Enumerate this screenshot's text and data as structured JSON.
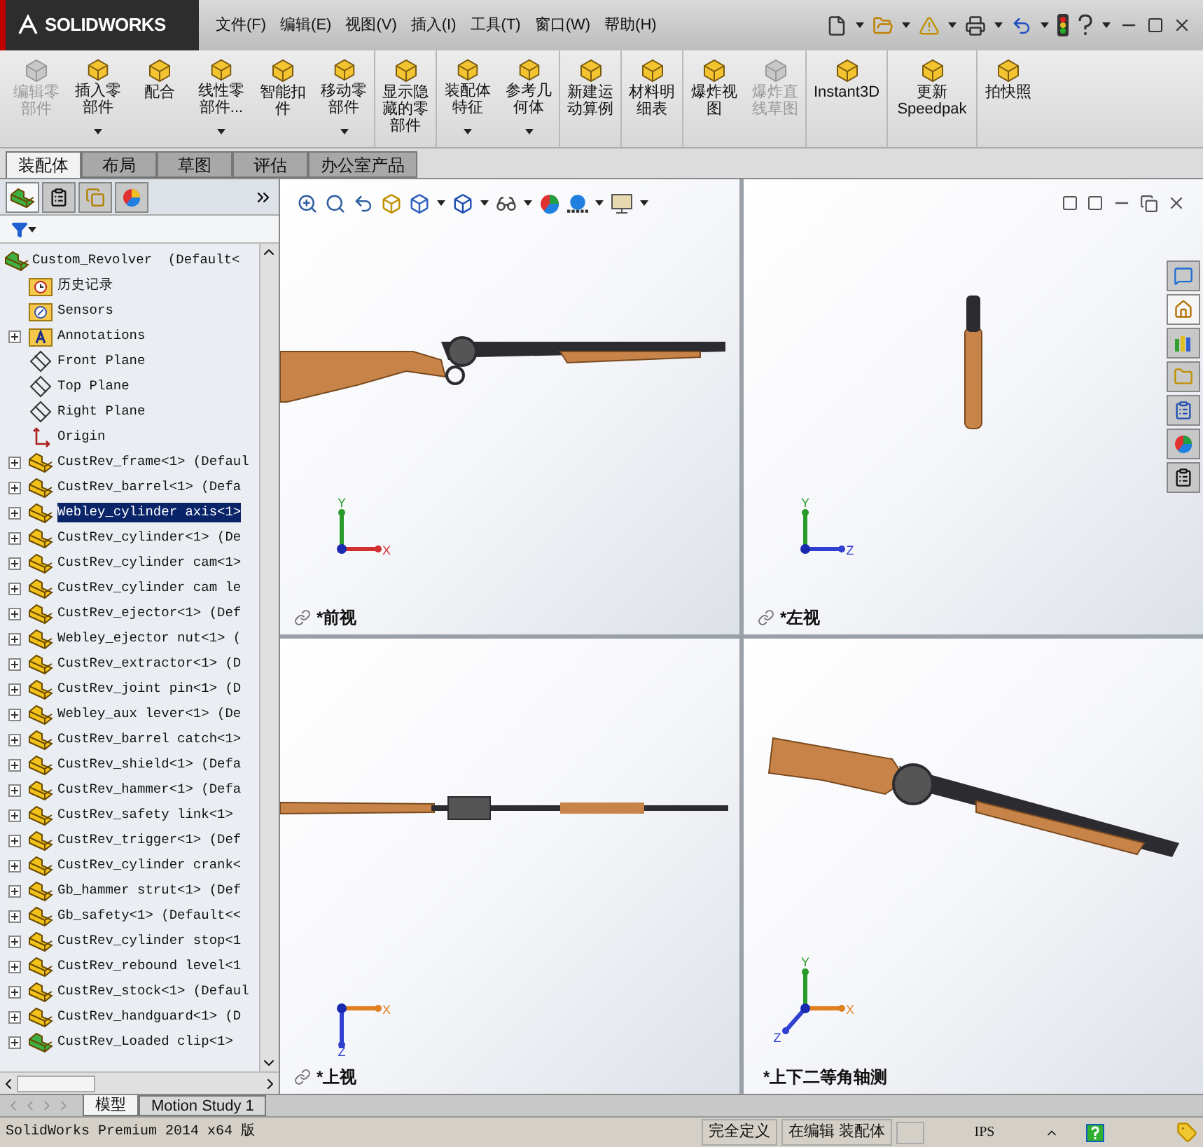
{
  "title_bar": {
    "logo": "SOLIDWORKS",
    "menu": [
      "文件(F)",
      "编辑(E)",
      "视图(V)",
      "插入(I)",
      "工具(T)",
      "窗口(W)",
      "帮助(H)"
    ]
  },
  "toolbar": [
    {
      "label": "编辑零部件",
      "disabled": true,
      "dropdown": false
    },
    {
      "label": "插入零部件",
      "disabled": false,
      "dropdown": true
    },
    {
      "label": "配合",
      "disabled": false,
      "dropdown": false
    },
    {
      "label": "线性零部件...",
      "disabled": false,
      "dropdown": true
    },
    {
      "label": "智能扣件",
      "disabled": false,
      "dropdown": false
    },
    {
      "label": "移动零部件",
      "disabled": false,
      "dropdown": true
    },
    {
      "label": "显示隐藏的零部件",
      "disabled": false,
      "dropdown": false
    },
    {
      "label": "装配体特征",
      "disabled": false,
      "dropdown": true
    },
    {
      "label": "参考几何体",
      "disabled": false,
      "dropdown": true
    },
    {
      "label": "新建运动算例",
      "disabled": false,
      "dropdown": false
    },
    {
      "label": "材料明细表",
      "disabled": false,
      "dropdown": false
    },
    {
      "label": "爆炸视图",
      "disabled": false,
      "dropdown": false
    },
    {
      "label": "爆炸直线草图",
      "disabled": true,
      "dropdown": false
    },
    {
      "label": "Instant3D",
      "disabled": false,
      "dropdown": false
    },
    {
      "label": "更新 Speedpak",
      "disabled": false,
      "dropdown": false
    },
    {
      "label": "拍快照",
      "disabled": false,
      "dropdown": false
    }
  ],
  "command_tabs": [
    {
      "label": "装配体",
      "selected": true
    },
    {
      "label": "布局",
      "selected": false
    },
    {
      "label": "草图",
      "selected": false
    },
    {
      "label": "评估",
      "selected": false
    },
    {
      "label": "办公室产品",
      "selected": false
    }
  ],
  "feature_tree": {
    "root": "Custom_Revolver  (Default<",
    "items": [
      {
        "label": "历史记录",
        "kind": "history",
        "expandable": false,
        "selected": false
      },
      {
        "label": "Sensors",
        "kind": "sensors",
        "expandable": false,
        "selected": false
      },
      {
        "label": "Annotations",
        "kind": "annotations",
        "expandable": true,
        "selected": false
      },
      {
        "label": "Front Plane",
        "kind": "plane",
        "expandable": false,
        "selected": false
      },
      {
        "label": "Top Plane",
        "kind": "plane",
        "expandable": false,
        "selected": false
      },
      {
        "label": "Right Plane",
        "kind": "plane",
        "expandable": false,
        "selected": false
      },
      {
        "label": "Origin",
        "kind": "origin",
        "expandable": false,
        "selected": false
      },
      {
        "label": "CustRev_frame<1> (Defaul",
        "kind": "part",
        "expandable": true,
        "selected": false
      },
      {
        "label": "CustRev_barrel<1> (Defa",
        "kind": "part",
        "expandable": true,
        "selected": false
      },
      {
        "label": "Webley_cylinder axis<1>",
        "kind": "part",
        "expandable": true,
        "selected": true
      },
      {
        "label": "CustRev_cylinder<1> (De",
        "kind": "part",
        "expandable": true,
        "selected": false
      },
      {
        "label": "CustRev_cylinder cam<1>",
        "kind": "part",
        "expandable": true,
        "selected": false
      },
      {
        "label": "CustRev_cylinder cam le",
        "kind": "part",
        "expandable": true,
        "selected": false
      },
      {
        "label": "CustRev_ejector<1> (Def",
        "kind": "part",
        "expandable": true,
        "selected": false
      },
      {
        "label": "Webley_ejector nut<1> (",
        "kind": "part",
        "expandable": true,
        "selected": false
      },
      {
        "label": "CustRev_extractor<1> (D",
        "kind": "part",
        "expandable": true,
        "selected": false
      },
      {
        "label": "CustRev_joint pin<1> (D",
        "kind": "part",
        "expandable": true,
        "selected": false
      },
      {
        "label": "Webley_aux lever<1> (De",
        "kind": "part",
        "expandable": true,
        "selected": false
      },
      {
        "label": "CustRev_barrel catch<1>",
        "kind": "part",
        "expandable": true,
        "selected": false
      },
      {
        "label": "CustRev_shield<1> (Defa",
        "kind": "part",
        "expandable": true,
        "selected": false
      },
      {
        "label": "CustRev_hammer<1> (Defa",
        "kind": "part",
        "expandable": true,
        "selected": false
      },
      {
        "label": "CustRev_safety link<1>",
        "kind": "part",
        "expandable": true,
        "selected": false
      },
      {
        "label": "CustRev_trigger<1> (Def",
        "kind": "part",
        "expandable": true,
        "selected": false
      },
      {
        "label": "CustRev_cylinder crank<",
        "kind": "part",
        "expandable": true,
        "selected": false
      },
      {
        "label": "Gb_hammer strut<1> (Def",
        "kind": "part",
        "expandable": true,
        "selected": false
      },
      {
        "label": "Gb_safety<1> (Default<<",
        "kind": "part",
        "expandable": true,
        "selected": false
      },
      {
        "label": "CustRev_cylinder stop<1",
        "kind": "part",
        "expandable": true,
        "selected": false
      },
      {
        "label": "CustRev_rebound level<1",
        "kind": "part",
        "expandable": true,
        "selected": false
      },
      {
        "label": "CustRev_stock<1> (Defaul",
        "kind": "part",
        "expandable": true,
        "selected": false
      },
      {
        "label": "CustRev_handguard<1> (D",
        "kind": "part",
        "expandable": true,
        "selected": false
      },
      {
        "label": "CustRev_Loaded clip<1>",
        "kind": "subassembly",
        "expandable": true,
        "selected": false
      }
    ]
  },
  "viewports": [
    {
      "label": "*前视",
      "kind": "side",
      "linked": true,
      "axes": [
        {
          "label": "Y",
          "kind": "up",
          "color": "#2a9a2a"
        },
        {
          "label": "X",
          "kind": "right",
          "color": "#d03030"
        }
      ]
    },
    {
      "label": "*左视",
      "kind": "end",
      "linked": true,
      "axes": [
        {
          "label": "Y",
          "kind": "up",
          "color": "#2a9a2a"
        },
        {
          "label": "Z",
          "kind": "right",
          "color": "#3040d0"
        }
      ]
    },
    {
      "label": "*上视",
      "kind": "top",
      "linked": true,
      "axes": [
        {
          "label": "X",
          "kind": "right",
          "color": "#e08020"
        },
        {
          "label": "Z",
          "kind": "down",
          "color": "#3040d0"
        }
      ]
    },
    {
      "label": "*上下二等角轴测",
      "kind": "iso",
      "linked": false,
      "axes": [
        {
          "label": "Y",
          "kind": "up",
          "color": "#2a9a2a"
        },
        {
          "label": "X",
          "kind": "right",
          "color": "#e08020"
        },
        {
          "label": "Z",
          "kind": "downleft",
          "color": "#3040d0"
        }
      ]
    }
  ],
  "task_pane_tabs": [
    {
      "selected": false
    },
    {
      "selected": true
    },
    {
      "selected": false
    },
    {
      "selected": false
    },
    {
      "selected": false
    },
    {
      "selected": false
    },
    {
      "selected": false
    }
  ],
  "bottom_tabs": [
    {
      "label": "模型",
      "selected": true
    },
    {
      "label": "Motion Study 1",
      "selected": false
    }
  ],
  "status_bar": {
    "product": "SolidWorks Premium 2014 x64 版",
    "state": "完全定义",
    "mode": "在编辑 装配体",
    "units": "IPS"
  }
}
